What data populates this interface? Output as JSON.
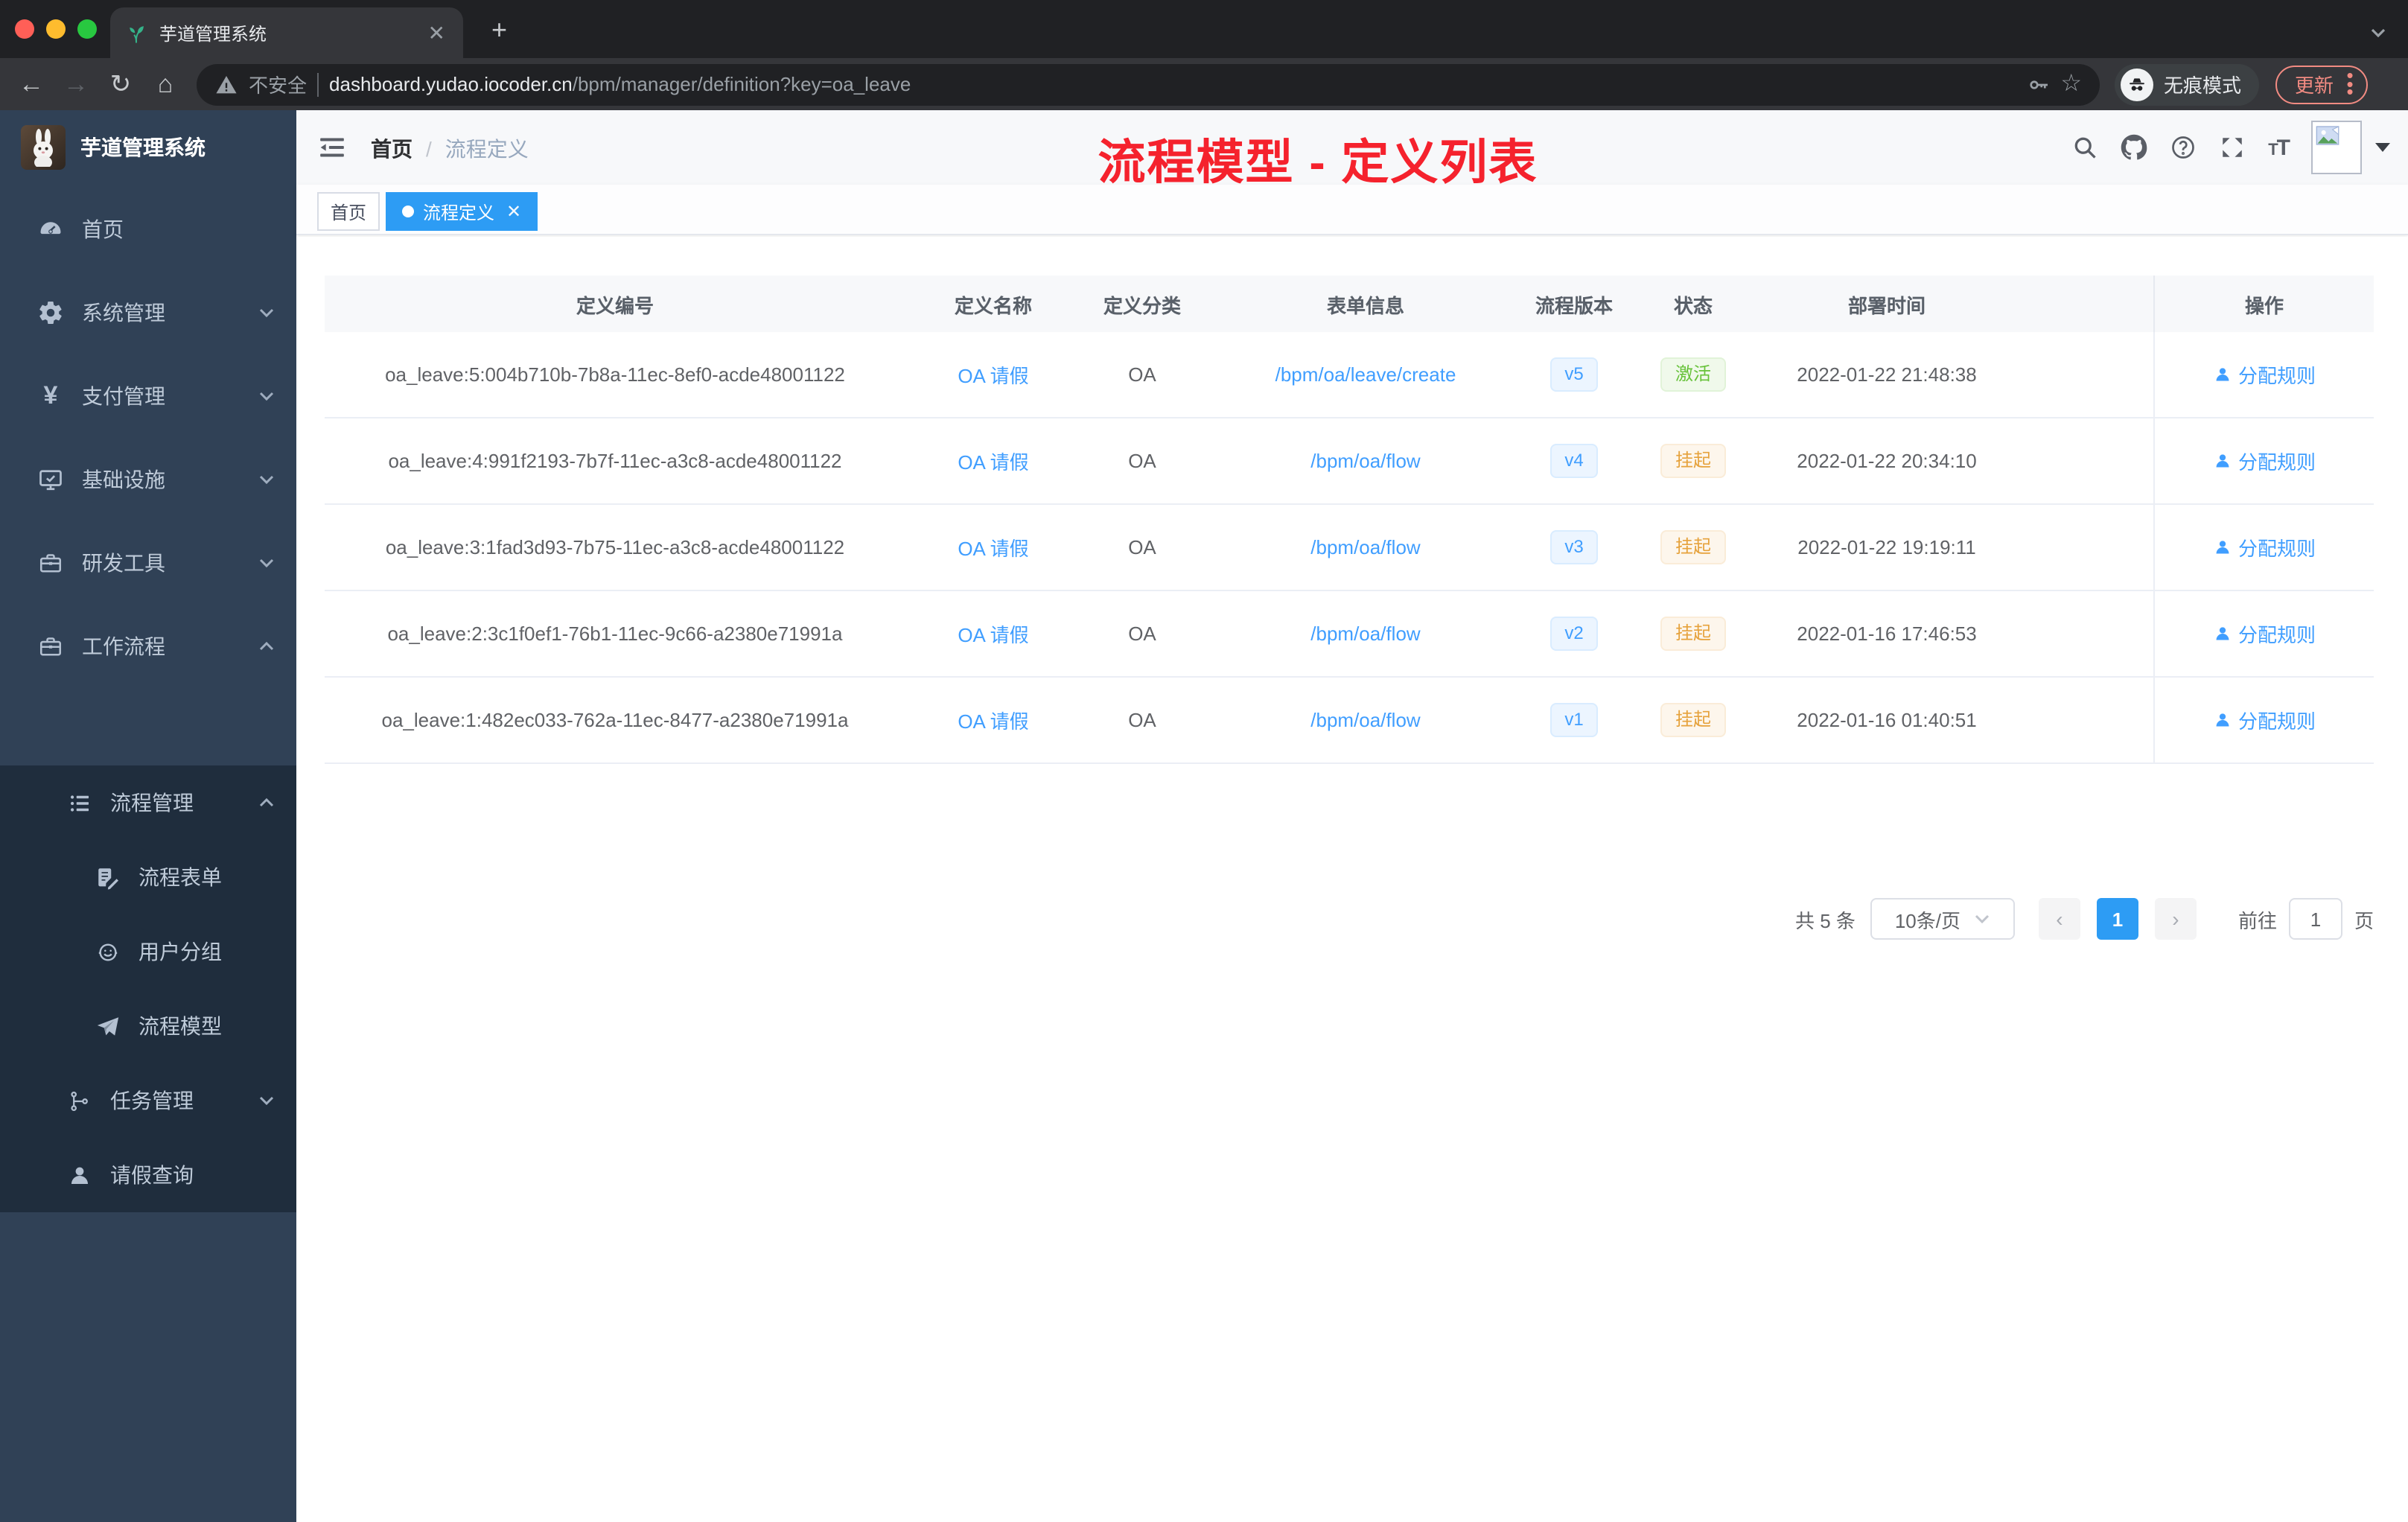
{
  "browser": {
    "tab_title": "芋道管理系统",
    "tab_favicon": "sprout-icon",
    "security_label": "不安全",
    "url_host": "dashboard.yudao.iocoder.cn",
    "url_path": "/bpm/manager/definition?key=oa_leave",
    "incognito_label": "无痕模式",
    "update_label": "更新",
    "toolbar_icons": [
      "back-icon",
      "forward-icon",
      "reload-icon",
      "home-icon",
      "key-icon",
      "star-icon"
    ]
  },
  "annotation": {
    "text": "流程模型 - 定义列表",
    "color": "#f5222d"
  },
  "sidebar": {
    "logo_title": "芋道管理系统",
    "items": [
      {
        "label": "首页",
        "icon": "dashboard-icon"
      },
      {
        "label": "系统管理",
        "icon": "gear-icon",
        "chevron": "down"
      },
      {
        "label": "支付管理",
        "icon": "yen-icon",
        "chevron": "down"
      },
      {
        "label": "基础设施",
        "icon": "monitor-icon",
        "chevron": "down"
      },
      {
        "label": "研发工具",
        "icon": "toolbox-icon",
        "chevron": "down"
      },
      {
        "label": "工作流程",
        "icon": "briefcase-icon",
        "chevron": "up"
      }
    ],
    "submenu": [
      {
        "label": "流程管理",
        "icon": "list-icon",
        "chevron": "up",
        "level": 1
      },
      {
        "label": "流程表单",
        "icon": "form-icon",
        "level": 2
      },
      {
        "label": "用户分组",
        "icon": "people-icon",
        "level": 2
      },
      {
        "label": "流程模型",
        "icon": "send-icon",
        "level": 2
      },
      {
        "label": "任务管理",
        "icon": "tree-icon",
        "chevron": "down",
        "level": 1
      },
      {
        "label": "请假查询",
        "icon": "user-icon",
        "level": 1
      }
    ]
  },
  "header": {
    "breadcrumb": {
      "home": "首页",
      "separator": "/",
      "current": "流程定义"
    },
    "right_icons": [
      "search-icon",
      "github-icon",
      "help-icon",
      "fullscreen-icon",
      "font-size-icon",
      "avatar",
      "caret-down-icon"
    ]
  },
  "tags": {
    "home": "首页",
    "active": "流程定义",
    "active_color": "#2d9cf4"
  },
  "table": {
    "headers": [
      "定义编号",
      "定义名称",
      "定义分类",
      "表单信息",
      "流程版本",
      "状态",
      "部署时间",
      "操作"
    ],
    "rows": [
      {
        "id": "oa_leave:5:004b710b-7b8a-11ec-8ef0-acde48001122",
        "name": "OA 请假",
        "category": "OA",
        "form": "/bpm/oa/leave/create",
        "version": "v5",
        "status": "激活",
        "status_type": "success",
        "time": "2022-01-22 21:48:38",
        "action": "分配规则"
      },
      {
        "id": "oa_leave:4:991f2193-7b7f-11ec-a3c8-acde48001122",
        "name": "OA 请假",
        "category": "OA",
        "form": "/bpm/oa/flow",
        "version": "v4",
        "status": "挂起",
        "status_type": "warning",
        "time": "2022-01-22 20:34:10",
        "action": "分配规则"
      },
      {
        "id": "oa_leave:3:1fad3d93-7b75-11ec-a3c8-acde48001122",
        "name": "OA 请假",
        "category": "OA",
        "form": "/bpm/oa/flow",
        "version": "v3",
        "status": "挂起",
        "status_type": "warning",
        "time": "2022-01-22 19:19:11",
        "action": "分配规则"
      },
      {
        "id": "oa_leave:2:3c1f0ef1-76b1-11ec-9c66-a2380e71991a",
        "name": "OA 请假",
        "category": "OA",
        "form": "/bpm/oa/flow",
        "version": "v2",
        "status": "挂起",
        "status_type": "warning",
        "time": "2022-01-16 17:46:53",
        "action": "分配规则"
      },
      {
        "id": "oa_leave:1:482ec033-762a-11ec-8477-a2380e71991a",
        "name": "OA 请假",
        "category": "OA",
        "form": "/bpm/oa/flow",
        "version": "v1",
        "status": "挂起",
        "status_type": "warning",
        "time": "2022-01-16 01:40:51",
        "action": "分配规则"
      }
    ]
  },
  "pagination": {
    "total": "共 5 条",
    "page_size": "10条/页",
    "current_page": "1",
    "goto_label": "前往",
    "goto_value": "1",
    "page_unit": "页"
  }
}
